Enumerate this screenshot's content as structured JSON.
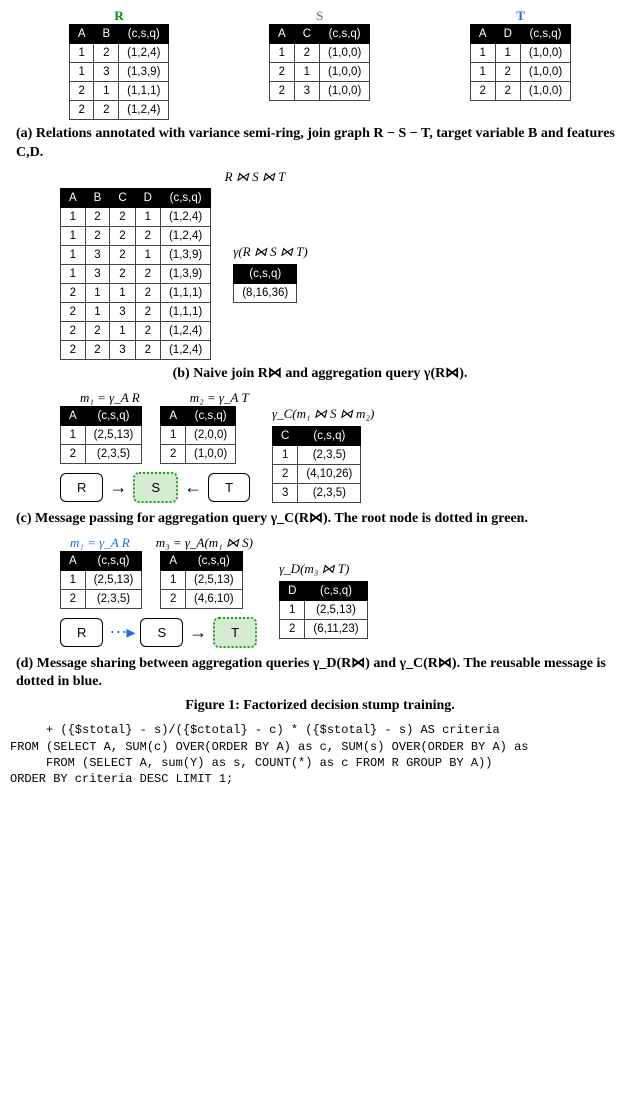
{
  "panelA": {
    "labels": {
      "R": "R",
      "S": "S",
      "T": "T"
    },
    "R": {
      "cols": [
        "A",
        "B",
        "(c,s,q)"
      ],
      "rows": [
        [
          "1",
          "2",
          "(1,2,4)"
        ],
        [
          "1",
          "3",
          "(1,3,9)"
        ],
        [
          "2",
          "1",
          "(1,1,1)"
        ],
        [
          "2",
          "2",
          "(1,2,4)"
        ]
      ]
    },
    "S": {
      "cols": [
        "A",
        "C",
        "(c,s,q)"
      ],
      "rows": [
        [
          "1",
          "2",
          "(1,0,0)"
        ],
        [
          "2",
          "1",
          "(1,0,0)"
        ],
        [
          "2",
          "3",
          "(1,0,0)"
        ]
      ]
    },
    "T": {
      "cols": [
        "A",
        "D",
        "(c,s,q)"
      ],
      "rows": [
        [
          "1",
          "1",
          "(1,0,0)"
        ],
        [
          "1",
          "2",
          "(1,0,0)"
        ],
        [
          "2",
          "2",
          "(1,0,0)"
        ]
      ]
    },
    "caption": "(a) Relations annotated with variance semi-ring, join graph R − S − T, target variable B and features C,D."
  },
  "panelB": {
    "title": "R ⋈ S ⋈ T",
    "join": {
      "cols": [
        "A",
        "B",
        "C",
        "D",
        "(c,s,q)"
      ],
      "rows": [
        [
          "1",
          "2",
          "2",
          "1",
          "(1,2,4)"
        ],
        [
          "1",
          "2",
          "2",
          "2",
          "(1,2,4)"
        ],
        [
          "1",
          "3",
          "2",
          "1",
          "(1,3,9)"
        ],
        [
          "1",
          "3",
          "2",
          "2",
          "(1,3,9)"
        ],
        [
          "2",
          "1",
          "1",
          "2",
          "(1,1,1)"
        ],
        [
          "2",
          "1",
          "3",
          "2",
          "(1,1,1)"
        ],
        [
          "2",
          "2",
          "1",
          "2",
          "(1,2,4)"
        ],
        [
          "2",
          "2",
          "3",
          "2",
          "(1,2,4)"
        ]
      ]
    },
    "agg_label": "γ(R ⋈ S ⋈ T)",
    "agg": {
      "cols": [
        "(c,s,q)"
      ],
      "rows": [
        [
          "(8,16,36)"
        ]
      ]
    },
    "caption": "(b) Naive join R⋈ and aggregation query γ(R⋈)."
  },
  "panelC": {
    "m1_label": "m₁ = γ_A R",
    "m2_label": "m₂ = γ_A T",
    "m1": {
      "cols": [
        "A",
        "(c,s,q)"
      ],
      "rows": [
        [
          "1",
          "(2,5,13)"
        ],
        [
          "2",
          "(2,3,5)"
        ]
      ]
    },
    "m2": {
      "cols": [
        "A",
        "(c,s,q)"
      ],
      "rows": [
        [
          "1",
          "(2,0,0)"
        ],
        [
          "2",
          "(1,0,0)"
        ]
      ]
    },
    "right_label": "γ_C(m₁ ⋈ S ⋈ m₂)",
    "right": {
      "cols": [
        "C",
        "(c,s,q)"
      ],
      "rows": [
        [
          "1",
          "(2,3,5)"
        ],
        [
          "2",
          "(4,10,26)"
        ],
        [
          "3",
          "(2,3,5)"
        ]
      ]
    },
    "nodes": {
      "R": "R",
      "S": "S",
      "T": "T"
    },
    "caption": "(c) Message passing for aggregation query γ_C(R⋈). The root node is dotted in green."
  },
  "panelD": {
    "m1_label": "m₁ = γ_A R",
    "m3_label": "m₃ = γ_A(m₁ ⋈ S)",
    "m1": {
      "cols": [
        "A",
        "(c,s,q)"
      ],
      "rows": [
        [
          "1",
          "(2,5,13)"
        ],
        [
          "2",
          "(2,3,5)"
        ]
      ]
    },
    "m3": {
      "cols": [
        "A",
        "(c,s,q)"
      ],
      "rows": [
        [
          "1",
          "(2,5,13)"
        ],
        [
          "2",
          "(4,6,10)"
        ]
      ]
    },
    "right_label": "γ_D(m₃ ⋈ T)",
    "right": {
      "cols": [
        "D",
        "(c,s,q)"
      ],
      "rows": [
        [
          "1",
          "(2,5,13)"
        ],
        [
          "2",
          "(6,11,23)"
        ]
      ]
    },
    "nodes": {
      "R": "R",
      "S": "S",
      "T": "T"
    },
    "caption": "(d) Message sharing between aggregation queries γ_D(R⋈) and γ_C(R⋈). The reusable message is dotted in blue."
  },
  "figure_caption": "Figure 1: Factorized decision stump training.",
  "code": {
    "l1": "     + ({$stotal} - s)/({$ctotal} - c) * ({$stotal} - s) AS criteria",
    "l2": "FROM (SELECT A, SUM(c) OVER(ORDER BY A) as c, SUM(s) OVER(ORDER BY A) as",
    "l3": "     FROM (SELECT A, sum(Y) as s, COUNT(*) as c FROM R GROUP BY A))",
    "l4": "ORDER BY criteria DESC LIMIT 1;"
  }
}
